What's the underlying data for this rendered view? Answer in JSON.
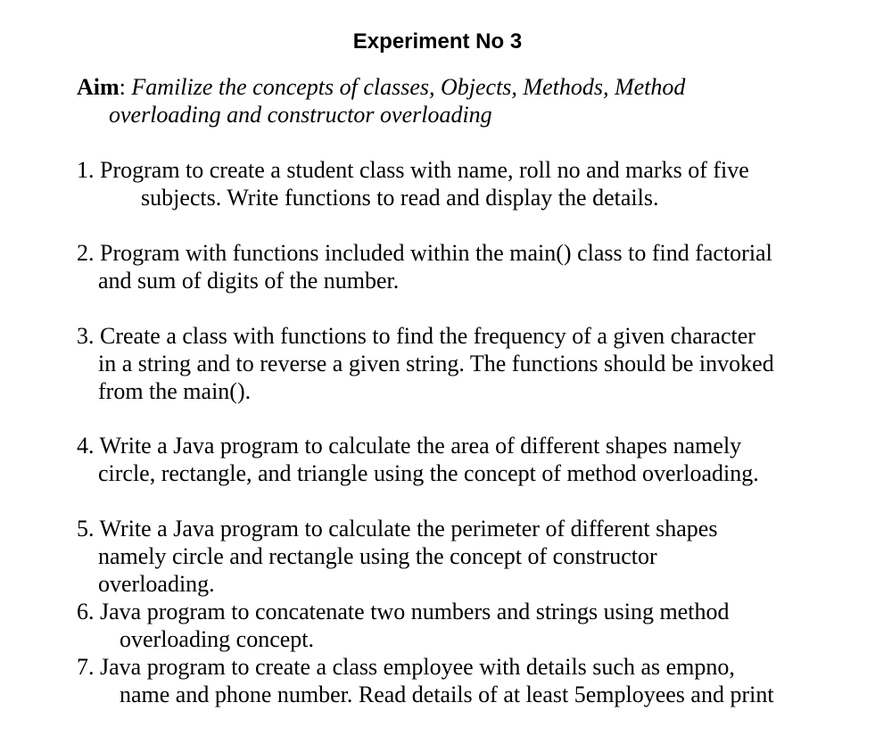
{
  "document": {
    "title": "Experiment No 3",
    "aim": {
      "label": "Aim",
      "colon": ": ",
      "line1": "Familize the concepts of classes, Objects, Methods, Method",
      "line2": "overloading and constructor overloading"
    },
    "items": [
      {
        "lines": [
          "1. Program to create a student class with name, roll no and marks of five",
          "subjects. Write functions to read and display the details."
        ]
      },
      {
        "lines": [
          "2. Program with functions included within the main() class to find factorial",
          "and sum of digits of the number."
        ]
      },
      {
        "lines": [
          "3. Create a class with functions to find the frequency of a given character",
          "in a string and to reverse a given string. The functions should be invoked",
          "from the main()."
        ]
      },
      {
        "lines": [
          "4. Write a Java program to calculate the area of different shapes namely",
          "circle, rectangle, and triangle using the concept of method overloading."
        ]
      },
      {
        "lines": [
          "5. Write a Java program to calculate the perimeter of different shapes",
          "namely circle and rectangle using the concept of constructor",
          "overloading."
        ]
      },
      {
        "lines": [
          "6. Java program to concatenate two numbers and strings using method",
          "overloading concept."
        ]
      },
      {
        "lines": [
          "7. Java program to create a class employee with details such as empno,",
          "name and phone number. Read details of at least 5employees and print"
        ]
      }
    ]
  }
}
